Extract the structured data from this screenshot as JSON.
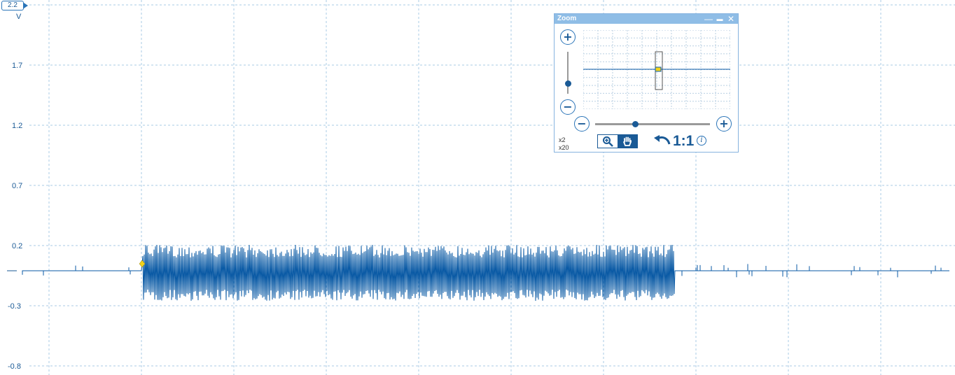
{
  "axis": {
    "scale_value": "2.2",
    "unit": "V",
    "ticks": [
      "1.7",
      "1.2",
      "0.7",
      "0.2",
      "-0.3",
      "-0.8"
    ]
  },
  "zoom_window": {
    "title": "Zoom",
    "minimize_label": "—",
    "restore_label": "▬",
    "close_label": "✕",
    "plus_label": "+",
    "minus_label": "−",
    "multiplier_x": "x2",
    "multiplier_y": "x20",
    "reset_label": "1:1",
    "info_label": "i",
    "vertical_zoom_level": 0.25,
    "horizontal_zoom_level": 0.35
  },
  "colors": {
    "trace": "#0a5aa5",
    "grid": "#a9cbe6",
    "trigger_marker": "#f2d21a",
    "window_title": "#8fbde6"
  },
  "icons": [
    "zoom-in-tool-icon",
    "hand-pan-tool-icon",
    "undo-icon",
    "info-icon"
  ]
}
